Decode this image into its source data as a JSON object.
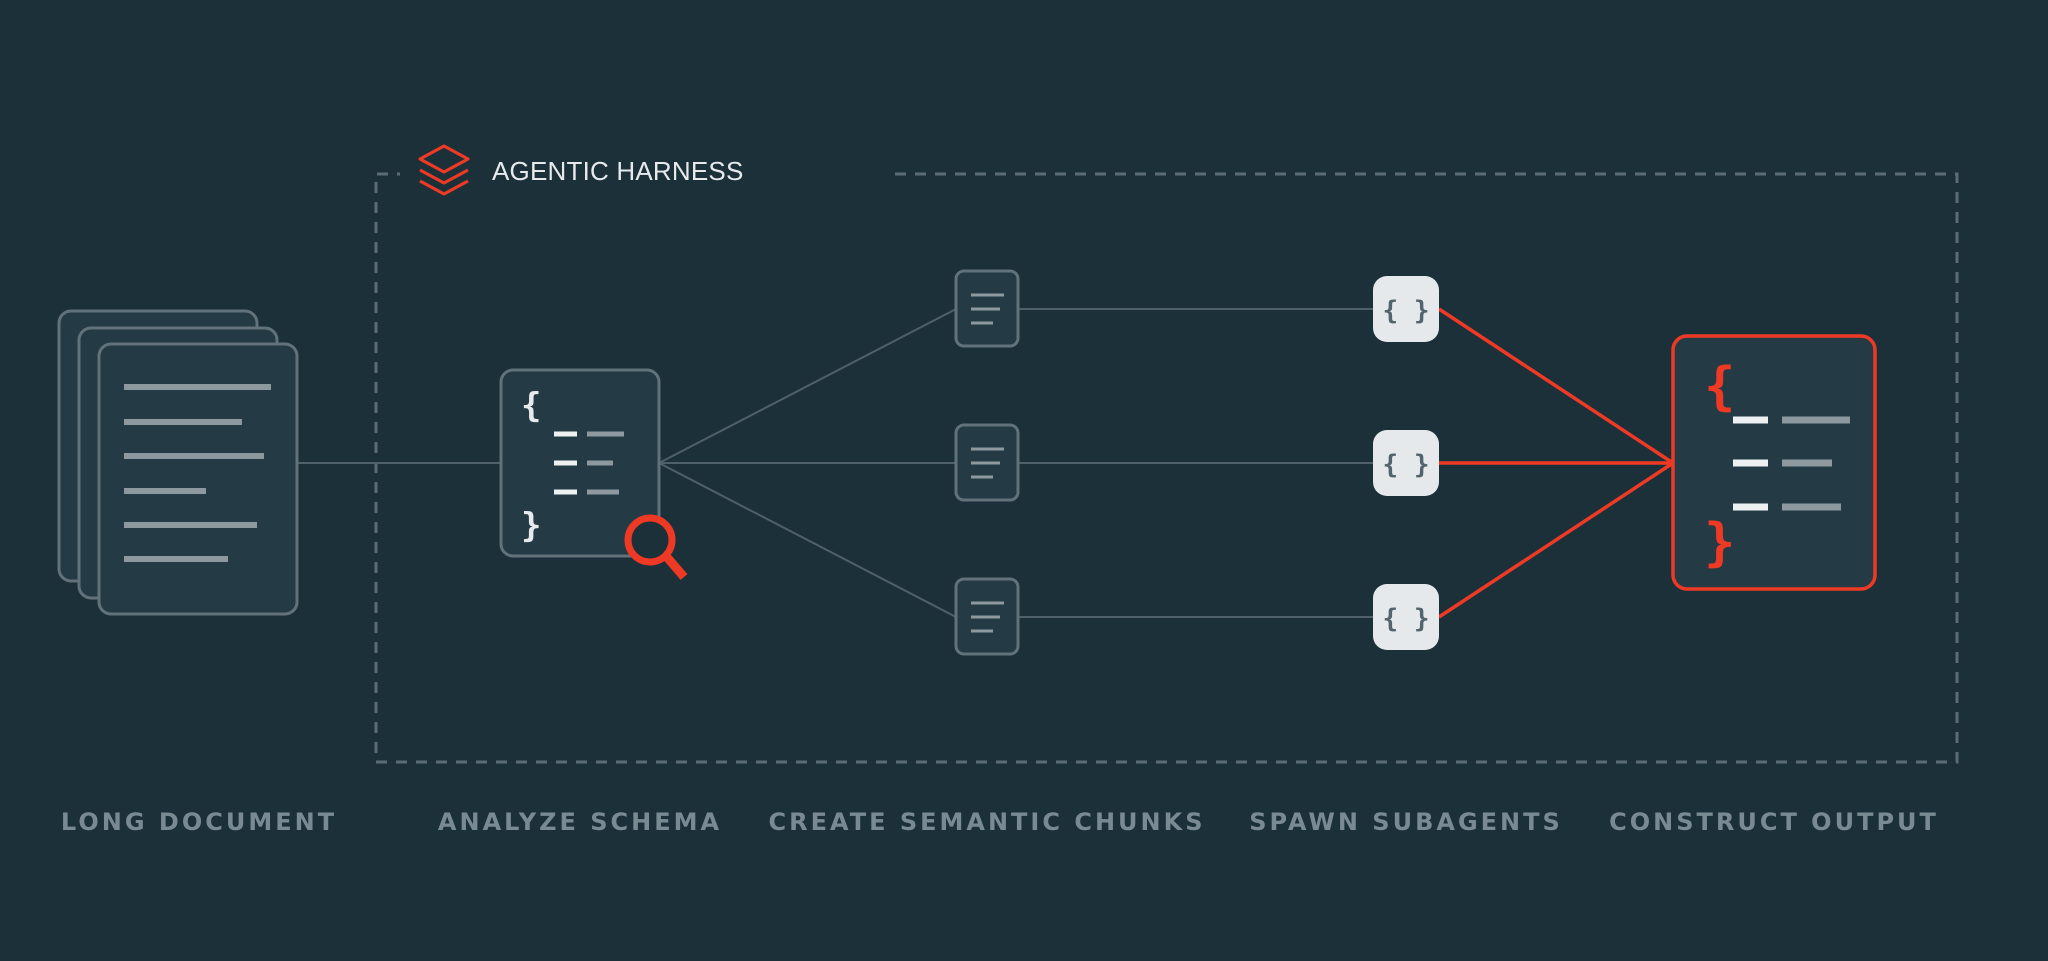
{
  "harness": {
    "title": "AGENTIC HARNESS",
    "icon": "layers-stack-icon"
  },
  "stages": [
    {
      "id": "long-document",
      "label": "LONG DOCUMENT"
    },
    {
      "id": "analyze-schema",
      "label": "ANALYZE SCHEMA"
    },
    {
      "id": "create-semantic-chunks",
      "label": "CREATE SEMANTIC CHUNKS"
    },
    {
      "id": "spawn-subagents",
      "label": "SPAWN SUBAGENTS"
    },
    {
      "id": "construct-output",
      "label": "CONSTRUCT OUTPUT"
    }
  ],
  "chunks_count": 3,
  "subagents_count": 3,
  "subagent_glyph": "{ }",
  "colors": {
    "background": "#1c303a",
    "card": "#243a45",
    "stroke": "#61727a",
    "accent": "#ee3a24",
    "text_light": "#e6eaec",
    "text_muted": "#7a8a92",
    "subagent_fill": "#e5e9eb"
  }
}
